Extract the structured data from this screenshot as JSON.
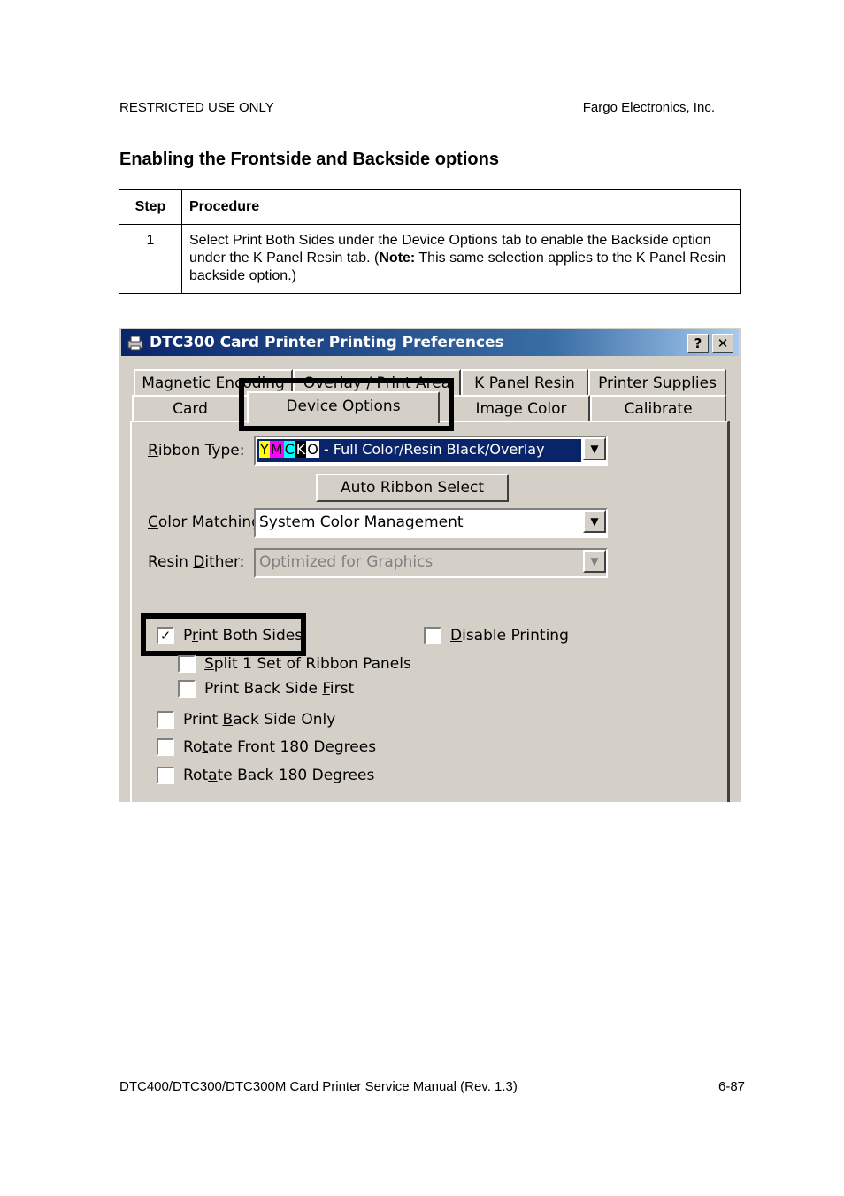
{
  "header": {
    "left": "RESTRICTED USE ONLY",
    "right": "Fargo Electronics, Inc."
  },
  "section_title": "Enabling the Frontside and Backside options",
  "table": {
    "col_step": "Step",
    "col_procedure": "Procedure",
    "rows": [
      {
        "step": "1",
        "text_before": "Select Print Both Sides under the Device Options tab to enable the Backside option under the K Panel Resin tab. (",
        "note_label": "Note:",
        "text_after": " This same selection applies to the K Panel Resin backside option.)"
      }
    ]
  },
  "dialog": {
    "title": "DTC300 Card Printer Printing Preferences",
    "help_button": "?",
    "close_button": "✕",
    "tabs_back": [
      "Magnetic Encoding",
      "Overlay / Print Area",
      "K Panel Resin",
      "Printer Supplies"
    ],
    "tabs_front": [
      "Card",
      "Device Options",
      "Image Color",
      "Calibrate"
    ],
    "active_tab": "Device Options",
    "ribbon_type": {
      "label_key": "R",
      "label_rest": "ibbon Type:",
      "badge": "YMCKO",
      "value": " - Full Color/Resin Black/Overlay"
    },
    "auto_ribbon_button": "Auto Ribbon Select",
    "color_matching": {
      "label_key": "C",
      "label_rest": "olor Matching:",
      "value": "System Color Management"
    },
    "resin_dither": {
      "label_pre": "Resin ",
      "label_key": "D",
      "label_rest": "ither:",
      "value": "Optimized for Graphics"
    },
    "checkboxes": {
      "print_both_sides": {
        "pre": "P",
        "key": "r",
        "post": "int Both Sides",
        "checked": true
      },
      "disable_printing": {
        "pre": "",
        "key": "D",
        "post": "isable Printing",
        "checked": false
      },
      "split_ribbon": {
        "pre": "",
        "key": "S",
        "post": "plit 1 Set of Ribbon Panels",
        "checked": false
      },
      "print_back_first": {
        "pre": "Print Back Side ",
        "key": "F",
        "post": "irst",
        "checked": false
      },
      "print_back_only": {
        "pre": "Print ",
        "key": "B",
        "post": "ack Side Only",
        "checked": false
      },
      "rotate_front": {
        "pre": "Ro",
        "key": "t",
        "post": "ate Front 180 Degrees",
        "checked": false
      },
      "rotate_back": {
        "pre": "Rot",
        "key": "a",
        "post": "te Back 180 Degrees",
        "checked": false
      }
    },
    "colors": {
      "titlebar": "#0a246a",
      "face": "#d4d0c8",
      "selection": "#0a246a"
    }
  },
  "footer": {
    "left": "DTC400/DTC300/DTC300M Card Printer Service Manual (Rev. 1.3)",
    "right": "6-87"
  }
}
